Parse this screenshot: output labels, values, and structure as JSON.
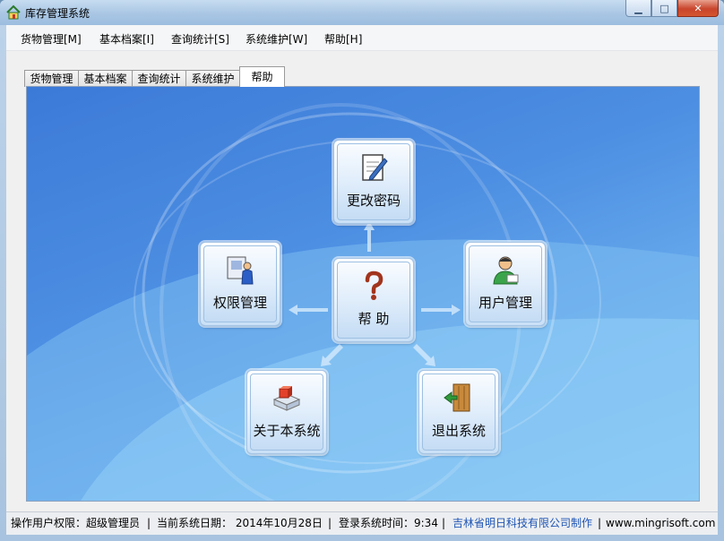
{
  "window": {
    "title": "库存管理系统"
  },
  "menubar": {
    "items": [
      "货物管理[M]",
      "基本档案[I]",
      "查询统计[S]",
      "系统维护[W]",
      "帮助[H]"
    ]
  },
  "tabs": [
    "货物管理",
    "基本档案",
    "查询统计",
    "系统维护",
    "帮助"
  ],
  "active_tab": "帮助",
  "panel": {
    "buttons": {
      "change_password": "更改密码",
      "permissions": "权限管理",
      "help": "帮 助",
      "user_management": "用户管理",
      "about": "关于本系统",
      "exit": "退出系统"
    }
  },
  "statusbar": {
    "user_role": "操作用户权限：超级管理员",
    "sep1": "|",
    "current_date": "当前系统日期：  2014年10月28日",
    "sep2": "|",
    "login_time": "登录系统时间：9:34",
    "sep3": "|",
    "company": "吉林省明日科技有限公司制作",
    "sep4": "|",
    "website": "www.mingrisoft.com"
  },
  "colors": {
    "accent": "#4d8fe2",
    "link": "#1f55b5"
  }
}
